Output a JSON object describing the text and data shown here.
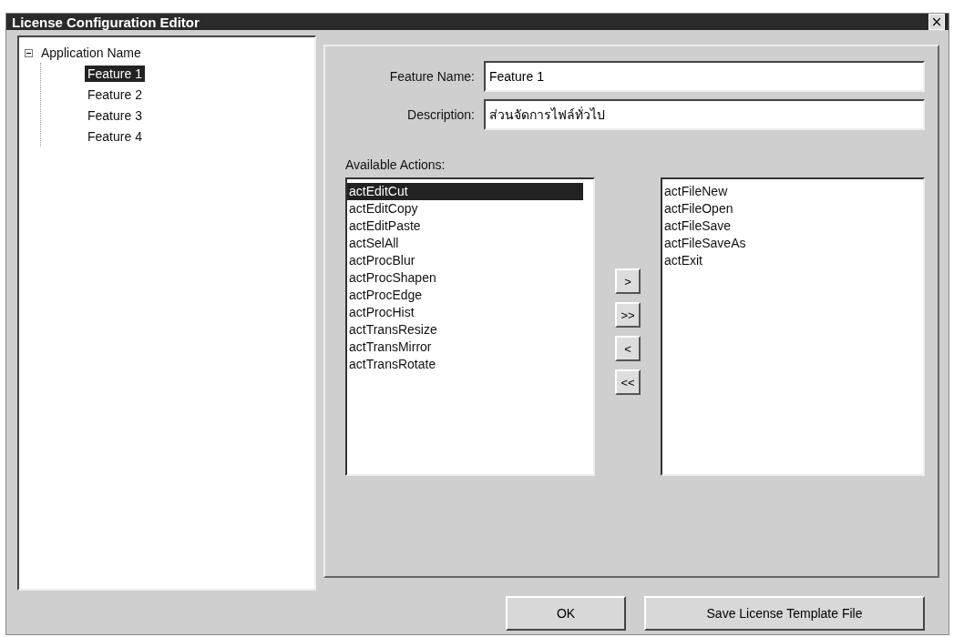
{
  "window": {
    "title": "License Configuration Editor",
    "close": "×"
  },
  "tree": {
    "label": "Application Name",
    "expanded": true,
    "children": [
      {
        "label": "Feature 1",
        "selected": true
      },
      {
        "label": "Feature 2",
        "selected": false
      },
      {
        "label": "Feature 3",
        "selected": false
      },
      {
        "label": "Feature 4",
        "selected": false
      }
    ]
  },
  "form": [
    {
      "label": "Feature Name:",
      "value": "Feature 1"
    },
    {
      "label": "Description:",
      "value": "ส่วนจัดการไฟล์ทั่วไป"
    }
  ],
  "available": {
    "label": "Available Actions:",
    "items": [
      {
        "label": "actEditCut",
        "selected": true
      },
      {
        "label": "actEditCopy",
        "selected": false
      },
      {
        "label": "actEditPaste",
        "selected": false
      },
      {
        "label": "actSelAll",
        "selected": false
      },
      {
        "label": "actProcBlur",
        "selected": false
      },
      {
        "label": "actProcShapen",
        "selected": false
      },
      {
        "label": "actProcEdge",
        "selected": false
      },
      {
        "label": "actProcHist",
        "selected": false
      },
      {
        "label": "actTransResize",
        "selected": false
      },
      {
        "label": "actTransMirror",
        "selected": false
      },
      {
        "label": "actTransRotate",
        "selected": false
      }
    ]
  },
  "move_buttons": [
    ">",
    ">>",
    "<",
    "<<"
  ],
  "assigned": {
    "items": [
      {
        "label": "actFileNew",
        "selected": false
      },
      {
        "label": "actFileOpen",
        "selected": false
      },
      {
        "label": "actFileSave",
        "selected": false
      },
      {
        "label": "actFileSaveAs",
        "selected": false
      },
      {
        "label": "actExit",
        "selected": false
      }
    ]
  },
  "buttons": [
    "OK",
    "Save License Template File"
  ]
}
